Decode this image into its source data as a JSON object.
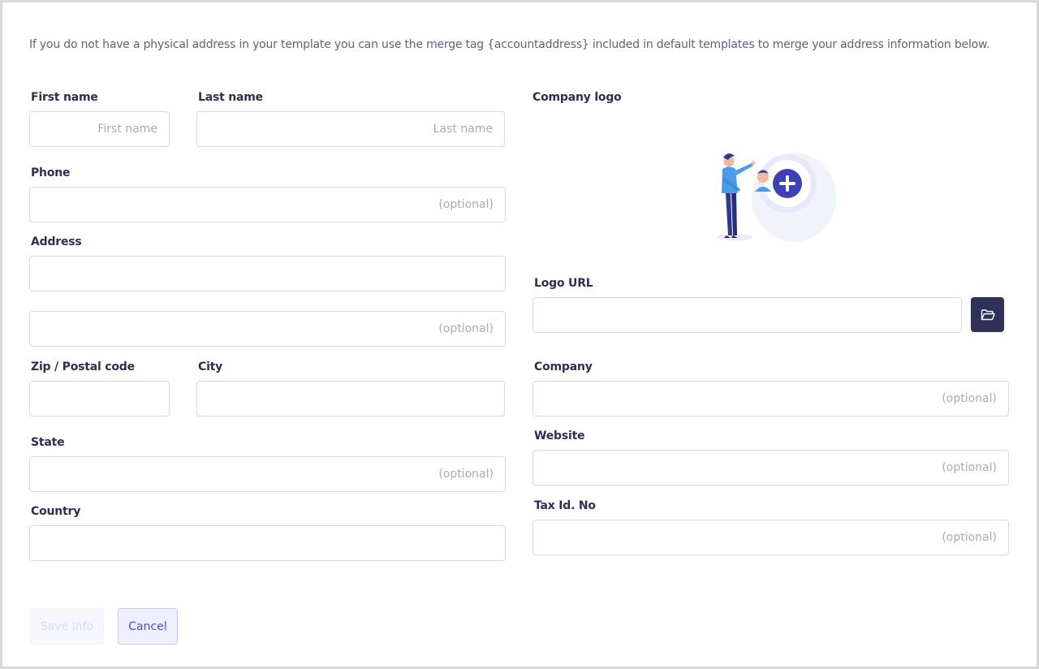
{
  "intro": "If you do not have a physical address in your template you can use the merge tag {accountaddress} included in default templates to merge your address information below.",
  "labels": {
    "first_name": "First name",
    "last_name": "Last name",
    "phone": "Phone",
    "address": "Address",
    "zip": "Zip / Postal code",
    "city": "City",
    "state": "State",
    "country": "Country",
    "company_logo": "Company logo",
    "logo_url": "Logo URL",
    "company": "Company",
    "website": "Website",
    "tax_id": "Tax Id. No"
  },
  "placeholders": {
    "first_name": "First name",
    "last_name": "Last name",
    "phone": "(optional)",
    "address1": "",
    "address2": "(optional)",
    "zip": "",
    "city": "",
    "state": "(optional)",
    "country": "",
    "logo_url": "",
    "company": "(optional)",
    "website": "(optional)",
    "tax_id": "(optional)"
  },
  "buttons": {
    "save": "Save Info",
    "cancel": "Cancel",
    "browse_icon": "folder-open-icon"
  },
  "colors": {
    "primary_dark": "#2f3157",
    "accent": "#4b4fc4",
    "placeholder": "#a9abbb"
  }
}
